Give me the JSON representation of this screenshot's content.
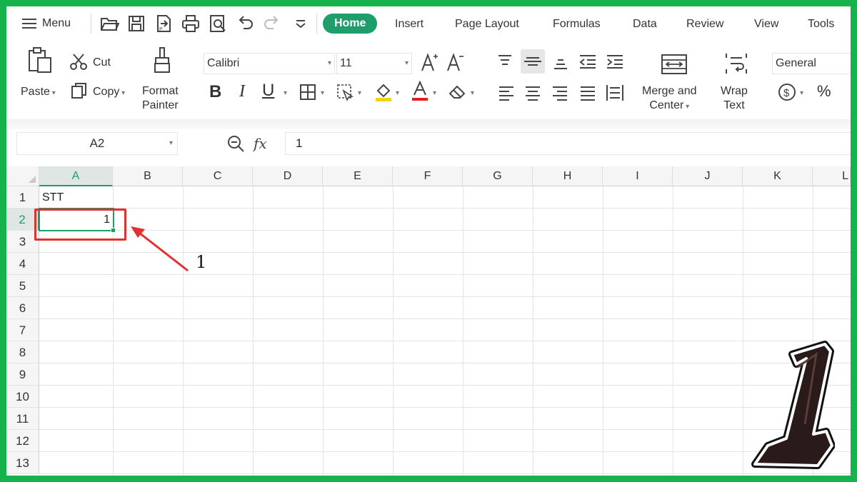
{
  "menubar": {
    "menu_label": "Menu",
    "tabs": [
      {
        "label": "Home",
        "active": true
      },
      {
        "label": "Insert"
      },
      {
        "label": "Page Layout"
      },
      {
        "label": "Formulas"
      },
      {
        "label": "Data"
      },
      {
        "label": "Review"
      },
      {
        "label": "View"
      },
      {
        "label": "Tools"
      }
    ],
    "quick_access_icons": [
      "open-folder-icon",
      "save-icon",
      "export-pdf-icon",
      "print-icon",
      "print-preview-icon",
      "undo-icon",
      "redo-icon",
      "customize-icon"
    ]
  },
  "ribbon": {
    "paste_label": "Paste",
    "cut_label": "Cut",
    "copy_label": "Copy",
    "format_painter_line1": "Format",
    "format_painter_line2": "Painter",
    "font_name": "Calibri",
    "font_size": "11",
    "merge_line1": "Merge and",
    "merge_line2": "Center",
    "wrap_line1": "Wrap",
    "wrap_line2": "Text",
    "number_format": "General",
    "percent": "%"
  },
  "formula_bar": {
    "name_box": "A2",
    "fx": "fx",
    "value": "1"
  },
  "sheet": {
    "columns": [
      "A",
      "B",
      "C",
      "D",
      "E",
      "F",
      "G",
      "H",
      "I",
      "J",
      "K",
      "L"
    ],
    "rows": [
      "1",
      "2",
      "3",
      "4",
      "5",
      "6",
      "7",
      "8",
      "9",
      "10",
      "11",
      "12",
      "13"
    ],
    "selected_column": "A",
    "selected_row": "2",
    "cells": {
      "A1": "STT",
      "A2": "1"
    }
  },
  "annotation": {
    "arrow_label": "1",
    "big_step_number": "1"
  },
  "colors": {
    "frame_green": "#16b34c",
    "accent": "#1f9d6b",
    "annotation_red": "#e03030"
  }
}
